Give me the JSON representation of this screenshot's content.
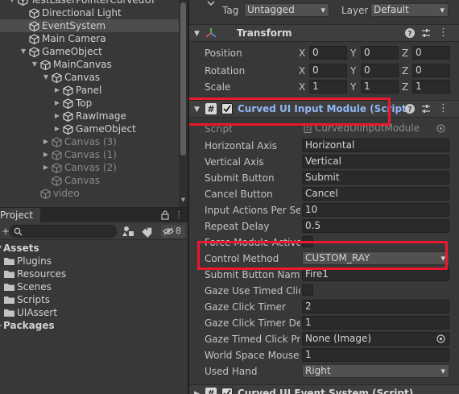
{
  "hierarchy": {
    "items": [
      {
        "label": "TestLaserPointerCurvedUI",
        "indent": 0,
        "arrow": "down",
        "selected": false,
        "dim": false
      },
      {
        "label": "Directional Light",
        "indent": 1,
        "arrow": "",
        "selected": false,
        "dim": false
      },
      {
        "label": "EventSystem",
        "indent": 1,
        "arrow": "",
        "selected": true,
        "dim": false
      },
      {
        "label": "Main Camera",
        "indent": 1,
        "arrow": "",
        "selected": false,
        "dim": false
      },
      {
        "label": "GameObject",
        "indent": 1,
        "arrow": "down",
        "selected": false,
        "dim": false
      },
      {
        "label": "MainCanvas",
        "indent": 2,
        "arrow": "down",
        "selected": false,
        "dim": false
      },
      {
        "label": "Canvas",
        "indent": 3,
        "arrow": "down",
        "selected": false,
        "dim": false
      },
      {
        "label": "Panel",
        "indent": 4,
        "arrow": "right",
        "selected": false,
        "dim": false
      },
      {
        "label": "Top",
        "indent": 4,
        "arrow": "right",
        "selected": false,
        "dim": false
      },
      {
        "label": "RawImage",
        "indent": 4,
        "arrow": "right",
        "selected": false,
        "dim": false
      },
      {
        "label": "GameObject",
        "indent": 4,
        "arrow": "right",
        "selected": false,
        "dim": false
      },
      {
        "label": "Canvas (3)",
        "indent": 3,
        "arrow": "right",
        "selected": false,
        "dim": true
      },
      {
        "label": "Canvas (1)",
        "indent": 3,
        "arrow": "right",
        "selected": false,
        "dim": true
      },
      {
        "label": "Canvas (2)",
        "indent": 3,
        "arrow": "right",
        "selected": false,
        "dim": true
      },
      {
        "label": "Canvas",
        "indent": 3,
        "arrow": "",
        "selected": false,
        "dim": true
      },
      {
        "label": "video",
        "indent": 2,
        "arrow": "",
        "selected": false,
        "dim": true
      }
    ]
  },
  "project": {
    "tab_label": "Project",
    "search_placeholder": "",
    "hidden_count": "8",
    "items": [
      {
        "label": "Assets",
        "indent": 0,
        "arrow": "down",
        "bold": true,
        "folder": true
      },
      {
        "label": "Plugins",
        "indent": 1,
        "arrow": "",
        "bold": false,
        "folder": true
      },
      {
        "label": "Resources",
        "indent": 1,
        "arrow": "",
        "bold": false,
        "folder": true
      },
      {
        "label": "Scenes",
        "indent": 1,
        "arrow": "",
        "bold": false,
        "folder": true
      },
      {
        "label": "Scripts",
        "indent": 1,
        "arrow": "",
        "bold": false,
        "folder": true
      },
      {
        "label": "UIAssert",
        "indent": 1,
        "arrow": "",
        "bold": false,
        "folder": true
      },
      {
        "label": "Packages",
        "indent": 0,
        "arrow": "right",
        "bold": true,
        "folder": false
      }
    ]
  },
  "inspector": {
    "tag_label": "Tag",
    "tag_value": "Untagged",
    "layer_label": "Layer",
    "layer_value": "Default",
    "transform": {
      "title": "Transform",
      "rows": [
        {
          "label": "Position",
          "x": "0",
          "y": "0",
          "z": "0"
        },
        {
          "label": "Rotation",
          "x": "0",
          "y": "0",
          "z": "0"
        },
        {
          "label": "Scale",
          "x": "1",
          "y": "1",
          "z": "1"
        }
      ],
      "axis_x": "X",
      "axis_y": "Y",
      "axis_z": "Z"
    },
    "input_module": {
      "title": "Curved UI Input Module (Script)",
      "enabled": true,
      "script_label": "Script",
      "script_value": "CurvedUIInputModule",
      "fields": [
        {
          "label": "Horizontal Axis",
          "type": "text",
          "value": "Horizontal"
        },
        {
          "label": "Vertical Axis",
          "type": "text",
          "value": "Vertical"
        },
        {
          "label": "Submit Button",
          "type": "text",
          "value": "Submit"
        },
        {
          "label": "Cancel Button",
          "type": "text",
          "value": "Cancel"
        },
        {
          "label": "Input Actions Per Second",
          "type": "text",
          "value": "10"
        },
        {
          "label": "Repeat Delay",
          "type": "text",
          "value": "0.5"
        },
        {
          "label": "Force Module Active",
          "type": "check",
          "value": ""
        },
        {
          "label": "Control Method",
          "type": "dropdown",
          "value": "CUSTOM_RAY"
        },
        {
          "label": "Submit Button Name",
          "type": "text",
          "value": "Fire1"
        },
        {
          "label": "Gaze Use Timed Click",
          "type": "check",
          "value": ""
        },
        {
          "label": "Gaze Click Timer",
          "type": "text",
          "value": "2"
        },
        {
          "label": "Gaze Click Timer Delay",
          "type": "text",
          "value": "1"
        },
        {
          "label": "Gaze Timed Click Progress Image",
          "type": "object",
          "value": "None (Image)"
        },
        {
          "label": "World Space Mouse Sensitivity",
          "type": "text",
          "value": "1"
        },
        {
          "label": "Used Hand",
          "type": "dropdown",
          "value": "Right"
        }
      ]
    },
    "event_system": {
      "title": "Curved UI Event System (Script)"
    }
  },
  "colors": {
    "highlight": "#e8192c",
    "script_title": "#8fb6f2",
    "panel_bg": "#383838",
    "field_bg": "#2a2a2a"
  }
}
